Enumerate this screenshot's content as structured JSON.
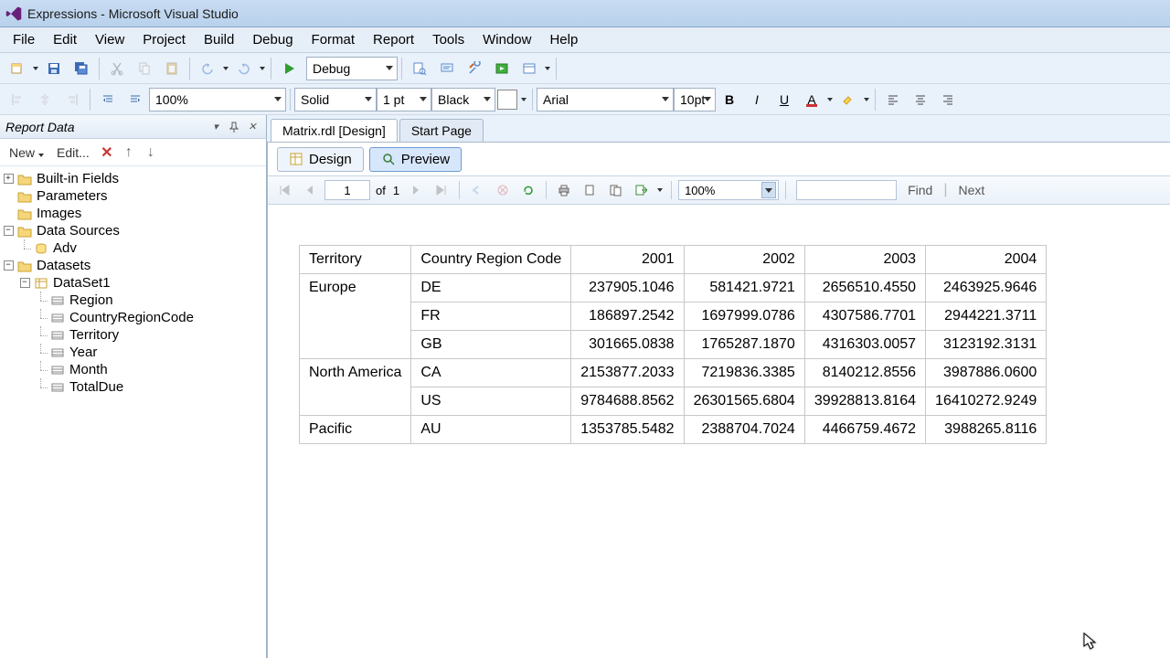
{
  "window": {
    "title": "Expressions - Microsoft Visual Studio"
  },
  "menu": {
    "file": "File",
    "edit": "Edit",
    "view": "View",
    "project": "Project",
    "build": "Build",
    "debug": "Debug",
    "format": "Format",
    "report": "Report",
    "tools": "Tools",
    "window": "Window",
    "help": "Help"
  },
  "toolbar1": {
    "config": "Debug"
  },
  "toolbar2": {
    "zoom": "100%",
    "lineStyle": "Solid",
    "lineWeight": "1 pt",
    "color": "Black",
    "font": "Arial",
    "fontSize": "10pt"
  },
  "panel": {
    "title": "Report Data",
    "newBtn": "New",
    "editBtn": "Edit...",
    "nodes": {
      "builtin": "Built-in Fields",
      "parameters": "Parameters",
      "images": "Images",
      "dataSources": "Data Sources",
      "adv": "Adv",
      "datasets": "Datasets",
      "dataset1": "DataSet1",
      "fields": [
        "Region",
        "CountryRegionCode",
        "Territory",
        "Year",
        "Month",
        "TotalDue"
      ]
    }
  },
  "docTabs": {
    "active": "Matrix.rdl [Design]",
    "start": "Start Page"
  },
  "subTabs": {
    "design": "Design",
    "preview": "Preview"
  },
  "previewTb": {
    "page": "1",
    "ofLabel": "of",
    "pageCount": "1",
    "zoom": "100%",
    "find": "Find",
    "next": "Next"
  },
  "matrix": {
    "headers": {
      "territory": "Territory",
      "crc": "Country Region Code",
      "y2001": "2001",
      "y2002": "2002",
      "y2003": "2003",
      "y2004": "2004"
    },
    "rows": [
      {
        "territory": "Europe",
        "code": "DE",
        "v": [
          "237905.1046",
          "581421.9721",
          "2656510.4550",
          "2463925.9646"
        ]
      },
      {
        "territory": "",
        "code": "FR",
        "v": [
          "186897.2542",
          "1697999.0786",
          "4307586.7701",
          "2944221.3711"
        ]
      },
      {
        "territory": "",
        "code": "GB",
        "v": [
          "301665.0838",
          "1765287.1870",
          "4316303.0057",
          "3123192.3131"
        ]
      },
      {
        "territory": "North America",
        "code": "CA",
        "v": [
          "2153877.2033",
          "7219836.3385",
          "8140212.8556",
          "3987886.0600"
        ]
      },
      {
        "territory": "",
        "code": "US",
        "v": [
          "9784688.8562",
          "26301565.6804",
          "39928813.8164",
          "16410272.9249"
        ]
      },
      {
        "territory": "Pacific",
        "code": "AU",
        "v": [
          "1353785.5482",
          "2388704.7024",
          "4466759.4672",
          "3988265.8116"
        ]
      }
    ]
  }
}
